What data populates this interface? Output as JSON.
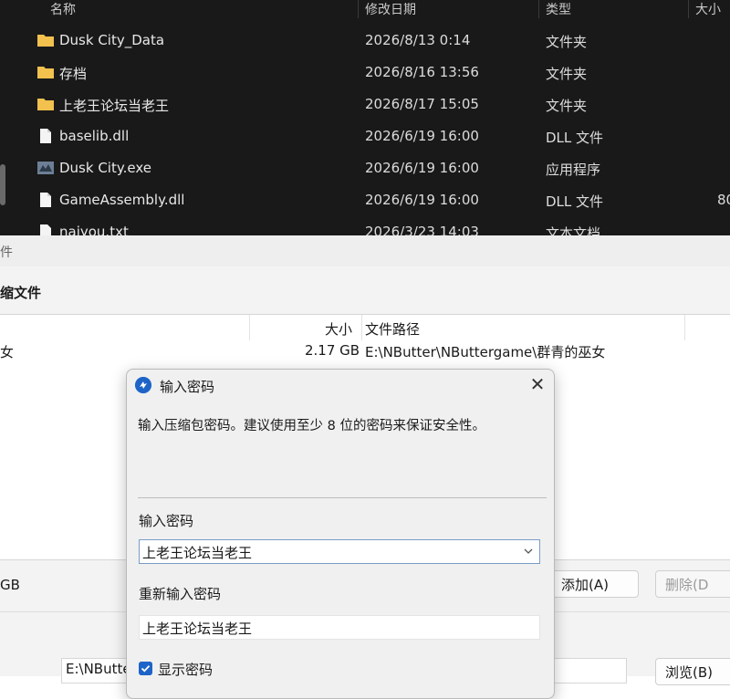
{
  "explorer": {
    "columns": {
      "name": "名称",
      "date": "修改日期",
      "type": "类型",
      "size": "大小"
    },
    "files": [
      {
        "icon": "folder-icon",
        "name": "Dusk City_Data",
        "date": "2026/8/13 0:14",
        "type": "文件夹",
        "size": ""
      },
      {
        "icon": "folder-icon",
        "name": "存档",
        "date": "2026/8/16 13:56",
        "type": "文件夹",
        "size": ""
      },
      {
        "icon": "folder-icon",
        "name": "上老王论坛当老王",
        "date": "2026/8/17 15:05",
        "type": "文件夹",
        "size": ""
      },
      {
        "icon": "file-icon",
        "name": "baselib.dll",
        "date": "2026/6/19 16:00",
        "type": "DLL 文件",
        "size": ""
      },
      {
        "icon": "exe-icon",
        "name": "Dusk City.exe",
        "date": "2026/6/19 16:00",
        "type": "应用程序",
        "size": ""
      },
      {
        "icon": "file-icon",
        "name": "GameAssembly.dll",
        "date": "2026/6/19 16:00",
        "type": "DLL 文件",
        "size": "80"
      },
      {
        "icon": "file-icon",
        "name": "naiyou.txt",
        "date": "2026/3/23 14:03",
        "type": "文本文档",
        "size": ""
      }
    ]
  },
  "archive_window": {
    "top_label": "件",
    "title": "缩文件",
    "col_size": "大小",
    "col_path": "文件路径",
    "row_name": "女",
    "row_size": "2.17 GB",
    "row_path": "E:\\NButter\\NButtergame\\群青的巫女",
    "total_size": "GB",
    "add_button": "添加(A)",
    "delete_button": "删除(D",
    "output_path": "E:\\NButte",
    "browse_button": "浏览(B)"
  },
  "dialog": {
    "title": "输入密码",
    "message": "输入压缩包密码。建议使用至少 8 位的密码来保证安全性。",
    "password_label": "输入密码",
    "password_value": "上老王论坛当老王",
    "retype_label": "重新输入密码",
    "retype_value": "上老王论坛当老王",
    "show_password_label": "显示密码",
    "show_password_checked": true
  },
  "colors": {
    "accent": "#1e64c8",
    "folder": "#f2c14e",
    "explorer_bg": "#191919"
  }
}
